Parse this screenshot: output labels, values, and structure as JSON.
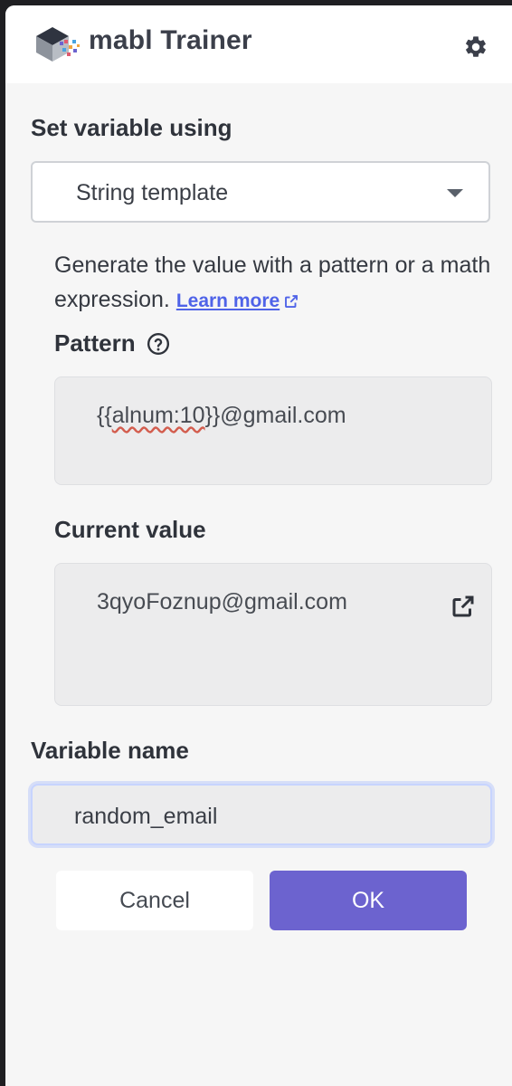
{
  "header": {
    "title": "mabl Trainer",
    "settings_icon": "gear-icon"
  },
  "form": {
    "set_variable_label": "Set variable using",
    "method": {
      "selected": "String template"
    },
    "description": "Generate the value with a pattern or a math expression.",
    "learn_more": "Learn more",
    "pattern": {
      "label": "Pattern",
      "value_prefix": "{{",
      "value_token": "alnum:10",
      "value_suffix": "}}@gmail.com"
    },
    "current_value": {
      "label": "Current value",
      "value": "3qyoFoznup@gmail.com"
    },
    "variable_name": {
      "label": "Variable name",
      "value": "random_email"
    }
  },
  "actions": {
    "cancel": "Cancel",
    "ok": "OK"
  },
  "colors": {
    "accent": "#6c63cf",
    "link": "#4f63e8"
  }
}
